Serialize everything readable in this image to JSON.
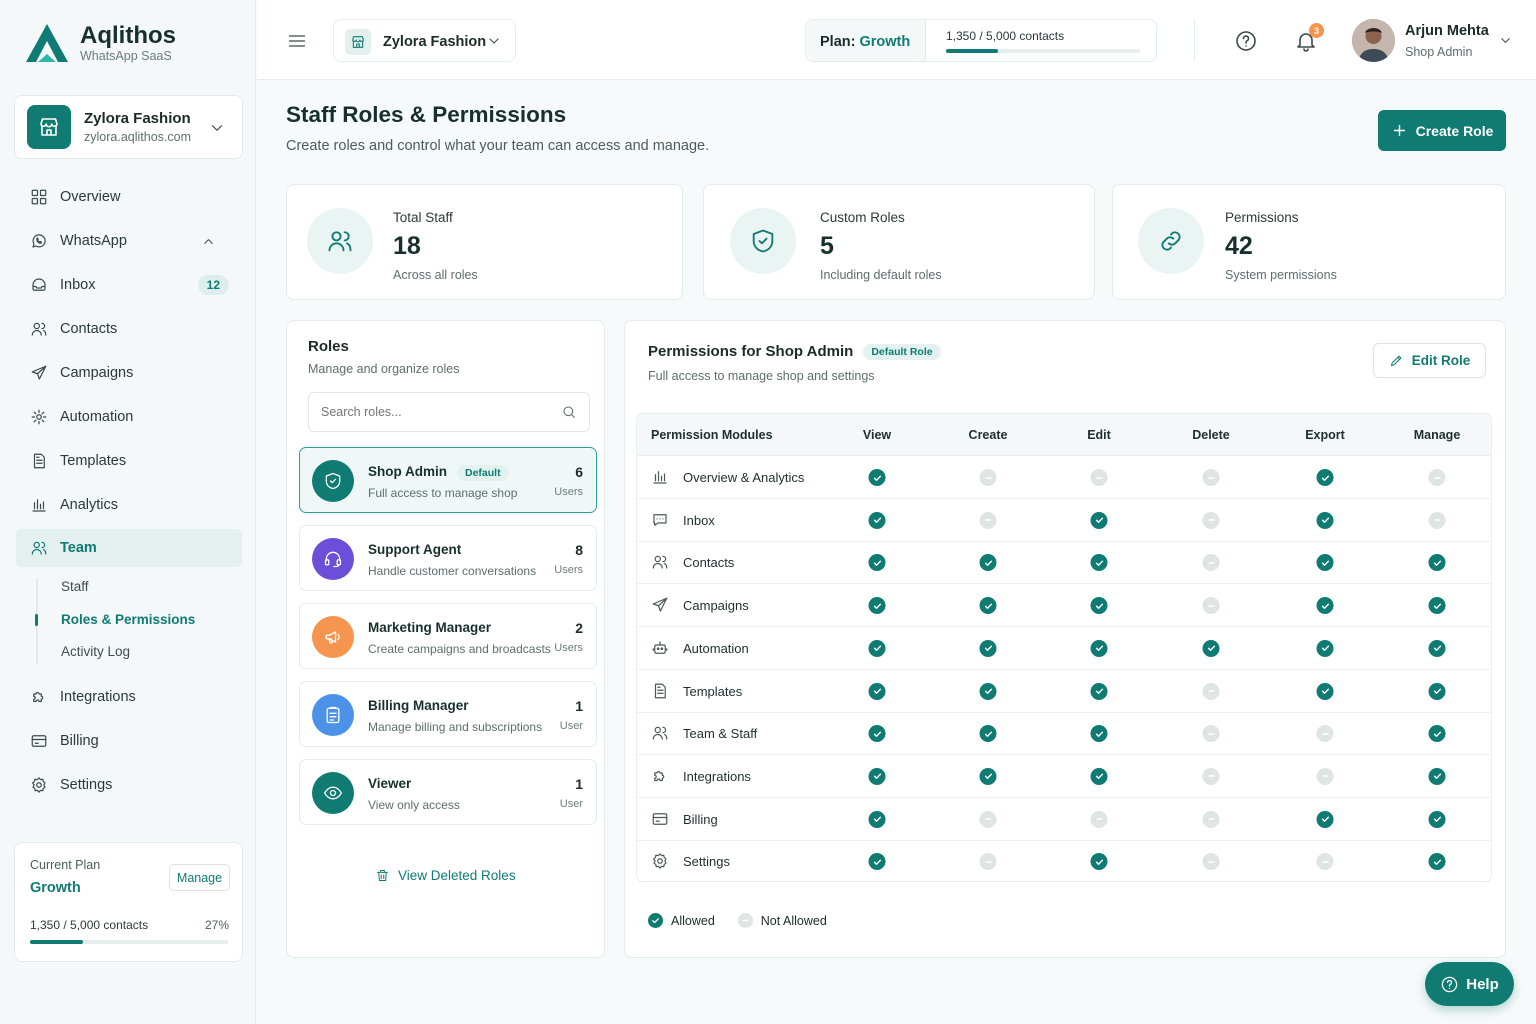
{
  "brand": {
    "name": "Aqlithos",
    "tagline": "WhatsApp SaaS"
  },
  "shop": {
    "name": "Zylora Fashion",
    "url": "zylora.aqlithos.com"
  },
  "nav": [
    {
      "label": "Overview",
      "icon": "grid-icon"
    },
    {
      "label": "WhatsApp",
      "icon": "whatsapp-icon"
    },
    {
      "label": "Inbox",
      "icon": "inbox-icon",
      "badge": "12"
    },
    {
      "label": "Contacts",
      "icon": "users-icon"
    },
    {
      "label": "Campaigns",
      "icon": "send-icon"
    },
    {
      "label": "Automation",
      "icon": "automation-icon"
    },
    {
      "label": "Templates",
      "icon": "document-icon"
    },
    {
      "label": "Analytics",
      "icon": "chart-icon"
    },
    {
      "label": "Team",
      "icon": "team-icon"
    },
    {
      "label": "Integrations",
      "icon": "puzzle-icon"
    },
    {
      "label": "Billing",
      "icon": "card-icon"
    },
    {
      "label": "Settings",
      "icon": "gear-icon"
    }
  ],
  "team_sub": [
    "Staff",
    "Roles & Permissions",
    "Activity Log"
  ],
  "plan_card": {
    "label": "Current Plan",
    "plan": "Growth",
    "manage": "Manage",
    "usage": "1,350 / 5,000 contacts",
    "percent_label": "27%",
    "percent": 27
  },
  "topbar": {
    "shop": "Zylora Fashion",
    "plan_label": "Plan:",
    "plan_value": "Growth",
    "contacts": "1,350 / 5,000 contacts",
    "contacts_fraction": 0.27,
    "notifications": "3",
    "user_name": "Arjun Mehta",
    "user_role": "Shop Admin"
  },
  "page": {
    "title": "Staff Roles & Permissions",
    "subtitle": "Create roles and control what your team can access and manage.",
    "create_role": "Create Role"
  },
  "stats": [
    {
      "label": "Total Staff",
      "value": "18",
      "sub": "Across all roles"
    },
    {
      "label": "Custom Roles",
      "value": "5",
      "sub": "Including default roles"
    },
    {
      "label": "Permissions",
      "value": "42",
      "sub": "System permissions"
    }
  ],
  "roles_panel": {
    "title": "Roles",
    "subtitle": "Manage and organize roles",
    "search_placeholder": "Search roles...",
    "deleted": "View Deleted Roles"
  },
  "roles": [
    {
      "name": "Shop Admin",
      "tag": "Default",
      "desc": "Full access to manage shop",
      "count": "6",
      "unit": "Users",
      "color": "#0f7b72"
    },
    {
      "name": "Support Agent",
      "tag": "",
      "desc": "Handle customer conversations",
      "count": "8",
      "unit": "Users",
      "color": "#6b4fd8"
    },
    {
      "name": "Marketing Manager",
      "tag": "",
      "desc": "Create campaigns and broadcasts",
      "count": "2",
      "unit": "Users",
      "color": "#f5954f"
    },
    {
      "name": "Billing Manager",
      "tag": "",
      "desc": "Manage billing and subscriptions",
      "count": "1",
      "unit": "User",
      "color": "#4c92e8"
    },
    {
      "name": "Viewer",
      "tag": "",
      "desc": "View only access",
      "count": "1",
      "unit": "User",
      "color": "#0f7b72"
    }
  ],
  "perm_panel": {
    "title": "Permissions for Shop Admin",
    "tag": "Default Role",
    "subtitle": "Full access to manage shop and settings",
    "edit": "Edit Role"
  },
  "columns": [
    "Permission Modules",
    "View",
    "Create",
    "Edit",
    "Delete",
    "Export",
    "Manage"
  ],
  "modules": [
    {
      "name": "Overview & Analytics",
      "icon": "chart-icon",
      "perms": [
        1,
        0,
        0,
        0,
        1,
        0
      ]
    },
    {
      "name": "Inbox",
      "icon": "chat-icon",
      "perms": [
        1,
        0,
        1,
        0,
        1,
        0
      ]
    },
    {
      "name": "Contacts",
      "icon": "users-icon",
      "perms": [
        1,
        1,
        1,
        0,
        1,
        1
      ]
    },
    {
      "name": "Campaigns",
      "icon": "send-icon",
      "perms": [
        1,
        1,
        1,
        0,
        1,
        1
      ]
    },
    {
      "name": "Automation",
      "icon": "robot-icon",
      "perms": [
        1,
        1,
        1,
        1,
        1,
        1
      ]
    },
    {
      "name": "Templates",
      "icon": "document-icon",
      "perms": [
        1,
        1,
        1,
        0,
        1,
        1
      ]
    },
    {
      "name": "Team & Staff",
      "icon": "team-icon",
      "perms": [
        1,
        1,
        1,
        0,
        0,
        1
      ]
    },
    {
      "name": "Integrations",
      "icon": "puzzle-icon",
      "perms": [
        1,
        1,
        1,
        0,
        0,
        1
      ]
    },
    {
      "name": "Billing",
      "icon": "card-icon",
      "perms": [
        1,
        0,
        0,
        0,
        1,
        1
      ]
    },
    {
      "name": "Settings",
      "icon": "gear-icon",
      "perms": [
        1,
        0,
        1,
        0,
        0,
        1
      ]
    }
  ],
  "legend": {
    "allowed": "Allowed",
    "not_allowed": "Not Allowed"
  },
  "help": "Help",
  "colors": {
    "accent": "#0f7b72",
    "allowed": "#0f7b72",
    "not_allowed": "#dfe5e5"
  }
}
